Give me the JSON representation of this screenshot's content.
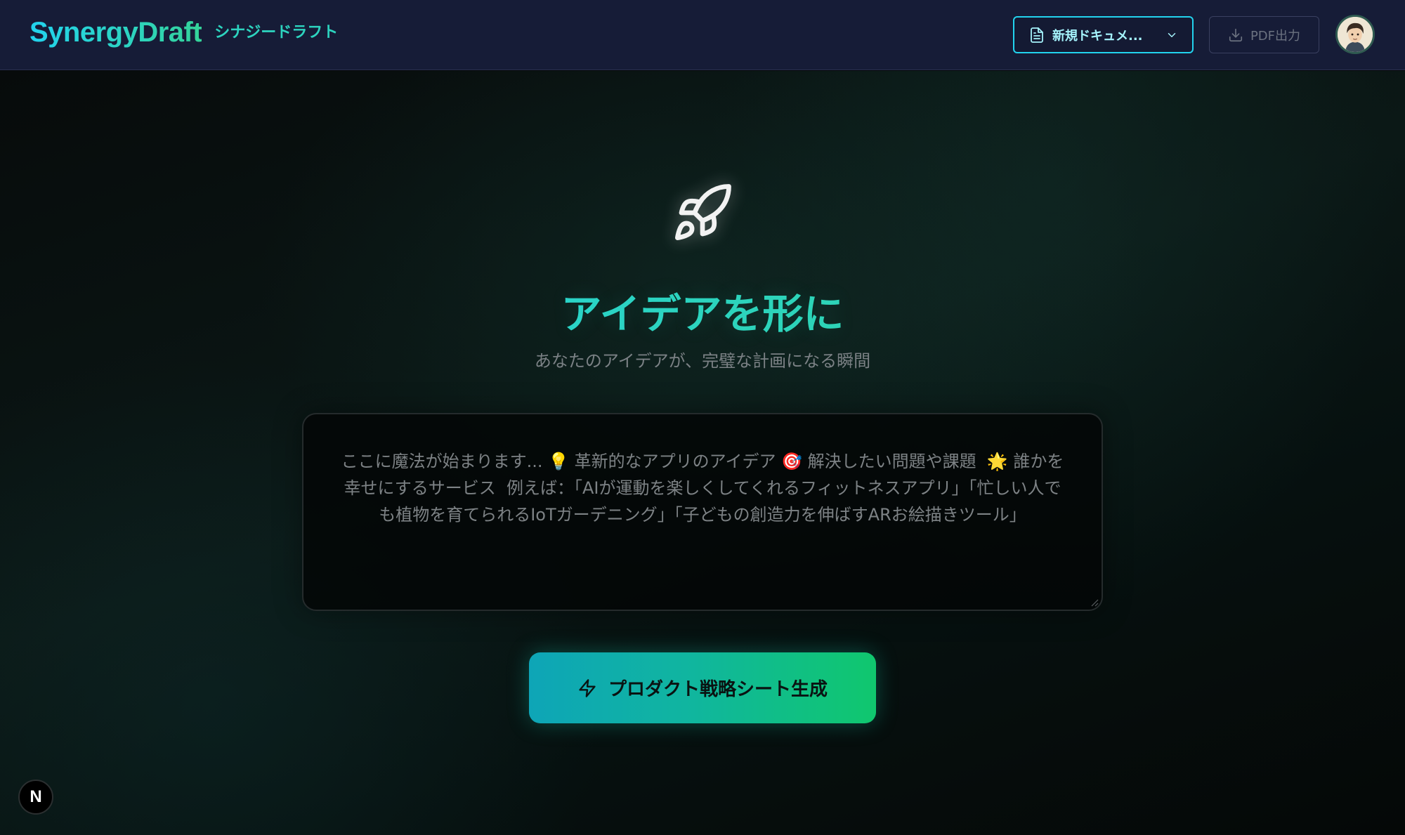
{
  "header": {
    "brand_name": "SynergyDraft",
    "brand_sub": "シナジードラフト",
    "doc_select_label": "新規ドキュメ...",
    "pdf_button_label": "PDF出力"
  },
  "hero": {
    "title": "アイデアを形に",
    "subtitle": "あなたのアイデアが、完璧な計画になる瞬間"
  },
  "idea_input": {
    "value": "",
    "placeholder": "ここに魔法が始まります... 💡 革新的なアプリのアイデア 🎯 解決したい問題や課題  🌟 誰かを幸せにするサービス  例えば：「AIが運動を楽しくしてくれるフィットネスアプリ」「忙しい人でも植物を育てられるIoTガーデニング」「子どもの創造力を伸ばすARお絵描きツール」"
  },
  "generate_button": {
    "label": "プロダクト戦略シート生成"
  },
  "badge": {
    "letter": "N"
  },
  "colors": {
    "accent_cyan": "#22d3ee",
    "accent_green": "#34d399",
    "header_bg": "#161c37"
  },
  "icons": {
    "rocket": "rocket-icon",
    "document": "document-icon",
    "chevron": "chevron-down-icon",
    "download": "download-icon",
    "bolt": "lightning-icon"
  }
}
